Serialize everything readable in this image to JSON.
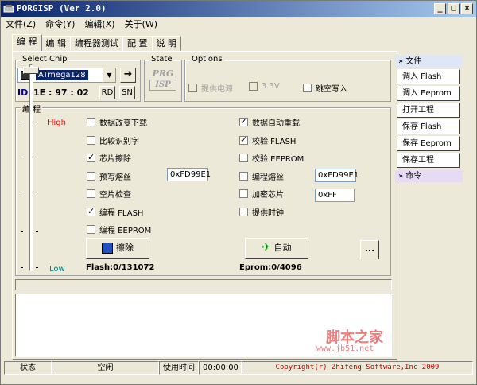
{
  "window": {
    "title": "PORGISP (Ver 2.0)"
  },
  "menu": [
    "文件(Z)",
    "命令(Y)",
    "编辑(X)",
    "关于(W)"
  ],
  "tabs": [
    "编 程",
    "编 辑",
    "编程器测试",
    "配 置",
    "说 明"
  ],
  "chip": {
    "group_label": "Select Chip",
    "selected": "ATmega128",
    "id_label": "ID:",
    "id_value": "1E : 97 : 02",
    "rd": "RD",
    "sn": "SN"
  },
  "state": {
    "group_label": "State",
    "logo_top": "PRG",
    "logo_bottom": "ISP"
  },
  "options": {
    "group_label": "Options",
    "power": "提供电源",
    "voltage": "3.3V",
    "skip_write": "跳空写入"
  },
  "program": {
    "group_label": "编 程",
    "high": "High",
    "low": "Low",
    "left": [
      {
        "label": "数据改变下载",
        "checked": false
      },
      {
        "label": "比较识别字",
        "checked": false
      },
      {
        "label": "芯片擦除",
        "checked": true
      },
      {
        "label": "预写熔丝",
        "checked": false
      },
      {
        "label": "空片检查",
        "checked": false
      },
      {
        "label": "编程 FLASH",
        "checked": true
      },
      {
        "label": "编程 EEPROM",
        "checked": false
      }
    ],
    "right": [
      {
        "label": "数据自动重载",
        "checked": true
      },
      {
        "label": "校验 FLASH",
        "checked": true
      },
      {
        "label": "校验 EEPROM",
        "checked": false
      },
      {
        "label": "编程熔丝",
        "checked": false
      },
      {
        "label": "加密芯片",
        "checked": false
      },
      {
        "label": "提供时钟",
        "checked": false
      }
    ],
    "prefuse_value": "0xFD99E1",
    "fuse_value": "0xFD99E1",
    "lock_value": "0xFF",
    "erase_button": "擦除",
    "auto_button": "自动",
    "more_button": "...",
    "flash_info": "Flash:0/131072",
    "eeprom_info": "Eprom:0/4096"
  },
  "sidebar": {
    "file_section": "文件",
    "buttons": [
      "调入 Flash",
      "调入 Eeprom",
      "打开工程",
      "保存 Flash",
      "保存 Eeprom",
      "保存工程"
    ],
    "cmd_section": "命令"
  },
  "status": {
    "state_label": "状态",
    "state_value": "空闲",
    "time_label": "使用时间",
    "time_value": "00:00:00",
    "copyright": "Copyright(r) Zhifeng Software,Inc 2009"
  },
  "watermark": {
    "text": "脚本之家",
    "url": "www.jb51.net"
  },
  "colors": {
    "high": "#ff0000",
    "low": "#008080",
    "copyright": "#c00000"
  }
}
